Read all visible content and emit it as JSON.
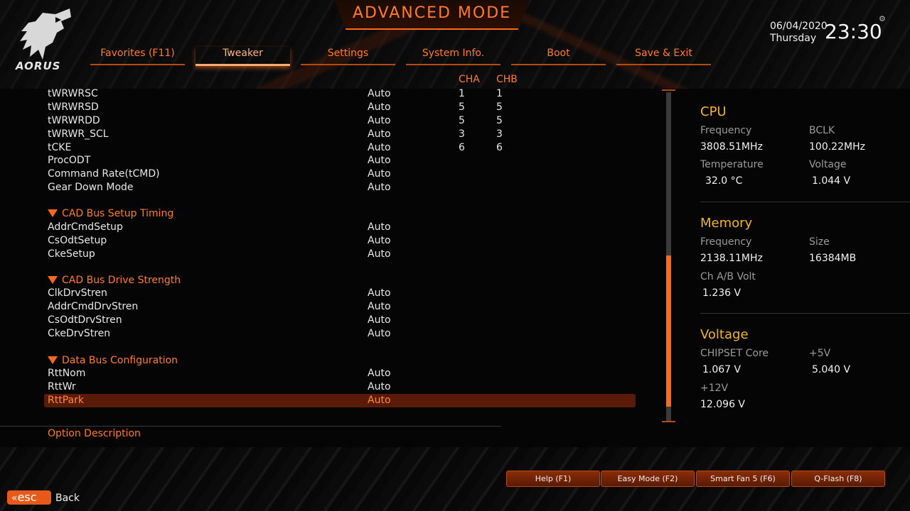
{
  "header": {
    "title": "ADVANCED MODE",
    "brand": "AORUS",
    "date": "06/04/2020",
    "day": "Thursday",
    "time": "23:30"
  },
  "tabs": [
    {
      "label": "Favorites (F11)",
      "active": false
    },
    {
      "label": "Tweaker",
      "active": true
    },
    {
      "label": "Settings",
      "active": false
    },
    {
      "label": "System Info.",
      "active": false
    },
    {
      "label": "Boot",
      "active": false
    },
    {
      "label": "Save & Exit",
      "active": false
    }
  ],
  "columns": {
    "cha": "CHA",
    "chb": "CHB"
  },
  "rows": [
    {
      "label": "tWRWRSC",
      "value": "Auto",
      "cha": "1",
      "chb": "1"
    },
    {
      "label": "tWRWRSD",
      "value": "Auto",
      "cha": "5",
      "chb": "5"
    },
    {
      "label": "tWRWRDD",
      "value": "Auto",
      "cha": "5",
      "chb": "5"
    },
    {
      "label": "tWRWR_SCL",
      "value": "Auto",
      "cha": "3",
      "chb": "3"
    },
    {
      "label": "tCKE",
      "value": "Auto",
      "cha": "6",
      "chb": "6"
    },
    {
      "label": "ProcODT",
      "value": "Auto"
    },
    {
      "label": "Command Rate(tCMD)",
      "value": "Auto"
    },
    {
      "label": "Gear Down Mode",
      "value": "Auto"
    }
  ],
  "sections": [
    {
      "title": "CAD Bus Setup Timing",
      "rows": [
        {
          "label": "AddrCmdSetup",
          "value": "Auto"
        },
        {
          "label": "CsOdtSetup",
          "value": "Auto"
        },
        {
          "label": "CkeSetup",
          "value": "Auto"
        }
      ]
    },
    {
      "title": "CAD Bus Drive Strength",
      "rows": [
        {
          "label": "ClkDrvStren",
          "value": "Auto"
        },
        {
          "label": "AddrCmdDrvStren",
          "value": "Auto"
        },
        {
          "label": "CsOdtDrvStren",
          "value": "Auto"
        },
        {
          "label": "CkeDrvStren",
          "value": "Auto"
        }
      ]
    },
    {
      "title": "Data Bus Configuration",
      "rows": [
        {
          "label": "RttNom",
          "value": "Auto"
        },
        {
          "label": "RttWr",
          "value": "Auto"
        },
        {
          "label": "RttPark",
          "value": "Auto",
          "selected": true
        }
      ]
    }
  ],
  "option_description": "Option Description",
  "cpu": {
    "title": "CPU",
    "frequency_label": "Frequency",
    "frequency": "3808.51MHz",
    "bclk_label": "BCLK",
    "bclk": "100.22MHz",
    "temperature_label": "Temperature",
    "temperature": "32.0 °C",
    "voltage_label": "Voltage",
    "voltage": "1.044 V"
  },
  "memory": {
    "title": "Memory",
    "frequency_label": "Frequency",
    "frequency": "2138.11MHz",
    "size_label": "Size",
    "size": "16384MB",
    "volt_label": "Ch A/B Volt",
    "volt": "1.236 V"
  },
  "voltage": {
    "title": "Voltage",
    "chipset_label": "CHIPSET Core",
    "chipset": "1.067 V",
    "p5v_label": "+5V",
    "p5v": "5.040 V",
    "p12v_label": "+12V",
    "p12v": "12.096 V"
  },
  "footer": {
    "help": "Help (F1)",
    "easy_mode": "Easy Mode (F2)",
    "smart_fan": "Smart Fan 5 (F6)",
    "qflash": "Q-Flash (F8)",
    "esc_label": "esc",
    "back": "Back"
  },
  "colors": {
    "accent": "#ff6a1a",
    "accent_text": "#ff7a2a",
    "panel_heading": "#f4b32a",
    "selected_row": "#5a1a08"
  },
  "icons": [
    "aorus-eagle-logo",
    "gear-icon",
    "section-triangle-icon",
    "double-chevron-left-icon"
  ]
}
